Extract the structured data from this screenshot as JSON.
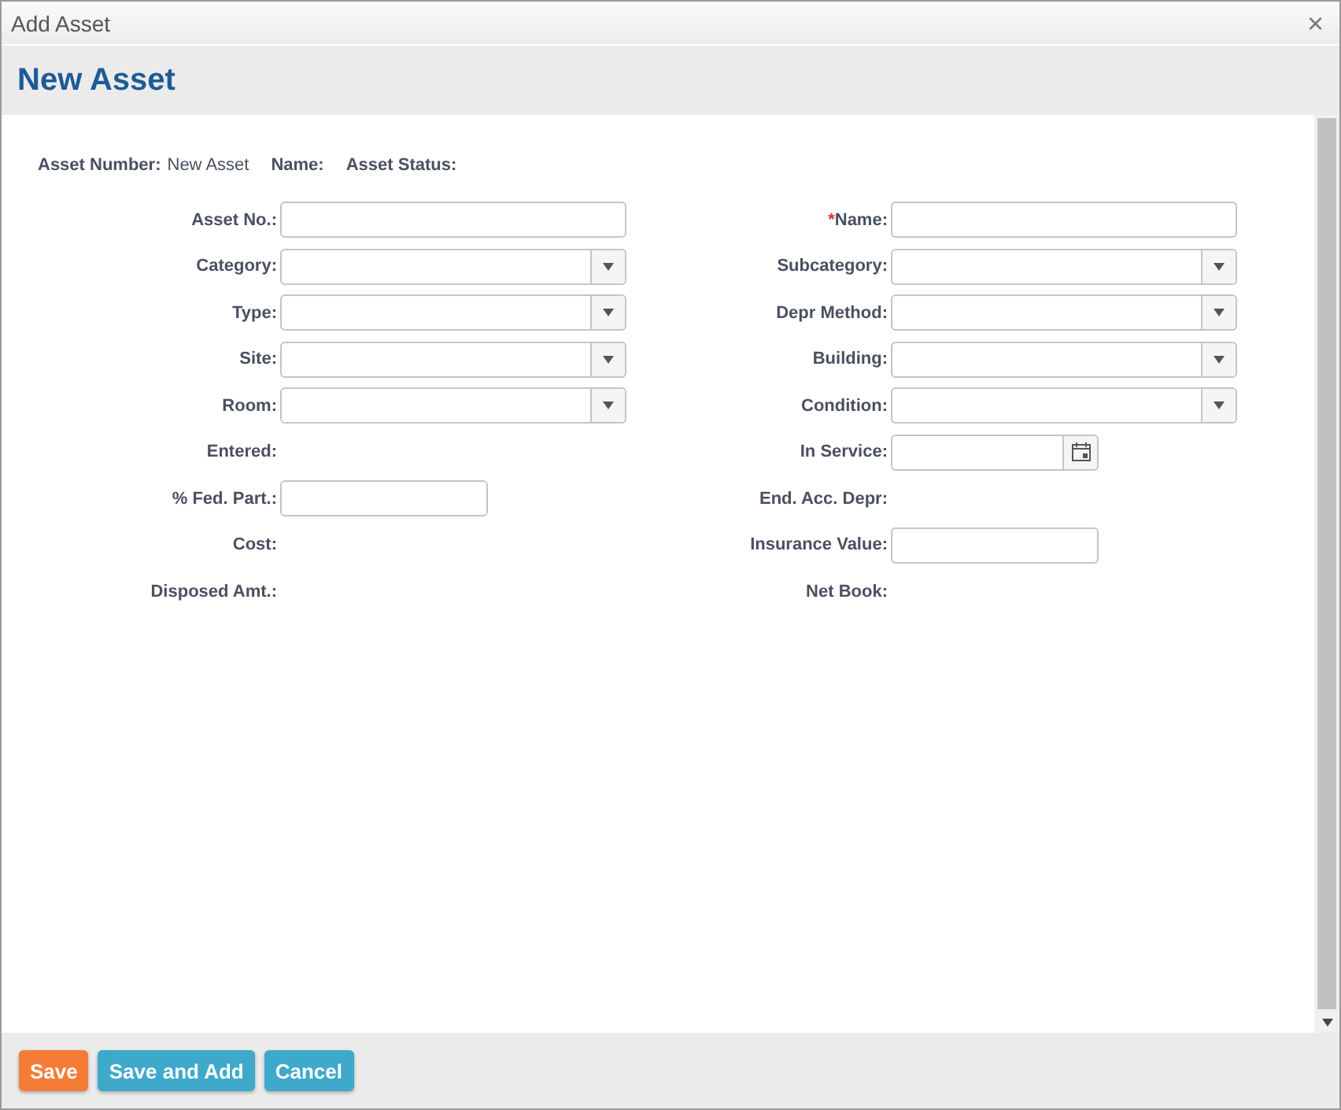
{
  "window": {
    "title": "Add Asset",
    "close": "×"
  },
  "header": {
    "title": "New Asset"
  },
  "required_mark": "*",
  "summary": [
    {
      "label": "Asset Number:",
      "value": "New Asset"
    },
    {
      "label": "Name:"
    },
    {
      "label": "Asset Status:"
    }
  ],
  "rows": [
    {
      "left": {
        "label": "Asset No.:",
        "kind": "text",
        "required": false
      },
      "right": {
        "label": "Name:",
        "kind": "text",
        "required": true
      }
    },
    {
      "left": {
        "label": "Category:",
        "kind": "select",
        "required": false
      },
      "right": {
        "label": "Subcategory:",
        "kind": "select",
        "required": false
      }
    },
    {
      "left": {
        "label": "Type:",
        "kind": "select",
        "required": false
      },
      "right": {
        "label": "Depr Method:",
        "kind": "select",
        "required": false
      }
    },
    {
      "left": {
        "label": "Site:",
        "kind": "select",
        "required": false
      },
      "right": {
        "label": "Building:",
        "kind": "select",
        "required": false
      }
    },
    {
      "left": {
        "label": "Room:",
        "kind": "select",
        "required": false
      },
      "right": {
        "label": "Condition:",
        "kind": "select",
        "required": false
      }
    },
    {
      "left": {
        "label": "Entered:",
        "kind": "none",
        "required": false
      },
      "right": {
        "label": "In Service:",
        "kind": "date",
        "required": false
      }
    },
    {
      "left": {
        "label": "% Fed. Part.:",
        "kind": "short",
        "required": false
      },
      "right": {
        "label": "End. Acc. Depr:",
        "kind": "none",
        "required": false
      }
    },
    {
      "left": {
        "label": "Cost:",
        "kind": "none",
        "required": false
      },
      "right": {
        "label": "Insurance Value:",
        "kind": "short",
        "required": false
      }
    },
    {
      "left": {
        "label": "Disposed Amt.:",
        "kind": "none",
        "required": false
      },
      "right": {
        "label": "Net Book:",
        "kind": "none",
        "required": false
      }
    }
  ],
  "buttons": [
    {
      "label": "Save",
      "kind": "primary"
    },
    {
      "label": "Save and Add",
      "kind": "secondary"
    },
    {
      "label": "Cancel",
      "kind": "secondary"
    }
  ]
}
